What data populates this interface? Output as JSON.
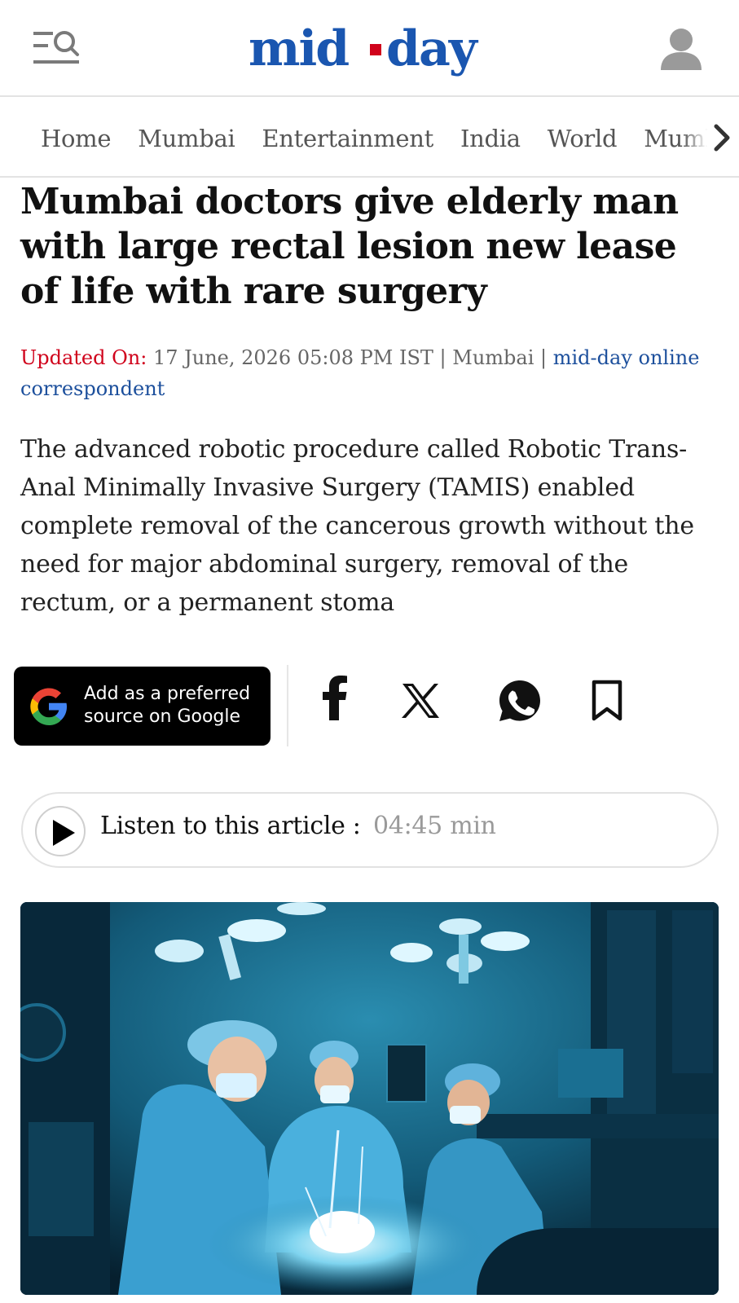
{
  "header": {
    "logo_text": "mid-day",
    "menu_icon": "menu-search-icon",
    "user_icon": "user-icon",
    "logo_color": "#1a56b0",
    "logo_dash_color": "#d0021b"
  },
  "nav": {
    "items": [
      {
        "label": "Home"
      },
      {
        "label": "Mumbai"
      },
      {
        "label": "Entertainment"
      },
      {
        "label": "India"
      },
      {
        "label": "World"
      },
      {
        "label": "Mumbai"
      }
    ],
    "more_icon": "chevron-right-icon"
  },
  "article": {
    "headline": "Mumbai doctors give elderly man with large rectal lesion new lease of life with rare surgery",
    "updated_label": "Updated On:",
    "updated_value": " 17 June, 2026 05:08 PM IST | Mumbai | ",
    "author": "mid-day online correspondent",
    "summary": "The advanced robotic procedure called Robotic Trans-Anal Minimally Invasive Surgery (TAMIS) enabled complete removal of the cancerous growth without the need for major abdominal surgery, removal of the rectum, or a permanent stoma"
  },
  "share": {
    "google_line1": "Add as a preferred",
    "google_line2": "source on Google",
    "icons": [
      "facebook-icon",
      "x-icon",
      "whatsapp-icon",
      "bookmark-icon"
    ]
  },
  "listen": {
    "label": "Listen to this article :",
    "duration": "04:45 min"
  },
  "colors": {
    "accent_red": "#d0021b",
    "link_blue": "#1c4f9c",
    "brand_blue": "#1a56b0"
  }
}
